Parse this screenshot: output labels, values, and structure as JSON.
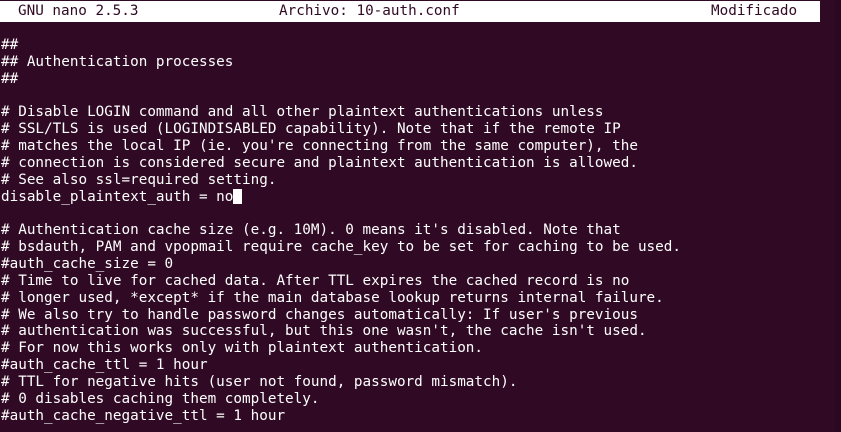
{
  "titlebar": {
    "app_version": "GNU nano 2.5.3",
    "file_label": "Archivo: 10-auth.conf",
    "status": "Modificado"
  },
  "buffer": {
    "lines": [
      "##",
      "## Authentication processes",
      "##",
      "",
      "# Disable LOGIN command and all other plaintext authentications unless",
      "# SSL/TLS is used (LOGINDISABLED capability). Note that if the remote IP",
      "# matches the local IP (ie. you're connecting from the same computer), the",
      "# connection is considered secure and plaintext authentication is allowed.",
      "# See also ssl=required setting.",
      "disable_plaintext_auth = no",
      "",
      "# Authentication cache size (e.g. 10M). 0 means it's disabled. Note that",
      "# bsdauth, PAM and vpopmail require cache_key to be set for caching to be used.",
      "#auth_cache_size = 0",
      "# Time to live for cached data. After TTL expires the cached record is no",
      "# longer used, *except* if the main database lookup returns internal failure.",
      "# We also try to handle password changes automatically: If user's previous",
      "# authentication was successful, but this one wasn't, the cache isn't used.",
      "# For now this works only with plaintext authentication.",
      "#auth_cache_ttl = 1 hour",
      "# TTL for negative hits (user not found, password mismatch).",
      "# 0 disables caching them completely.",
      "#auth_cache_negative_ttl = 1 hour"
    ]
  },
  "colors": {
    "background": "#300a24",
    "text": "#ffffff",
    "header_background": "#ffffff",
    "header_text": "#300a24"
  }
}
